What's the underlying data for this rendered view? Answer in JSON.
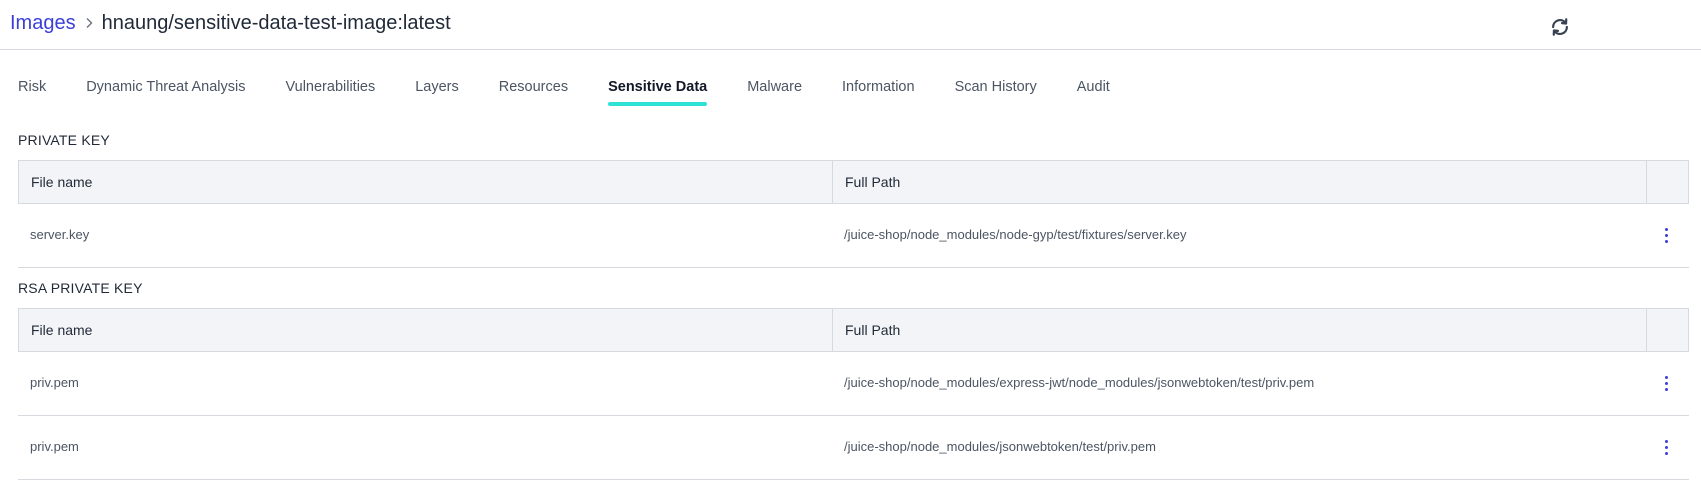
{
  "header": {
    "breadcrumb_link": "Images",
    "breadcrumb_current": "hnaung/sensitive-data-test-image:latest"
  },
  "tabs": [
    {
      "label": "Risk",
      "active": false
    },
    {
      "label": "Dynamic Threat Analysis",
      "active": false
    },
    {
      "label": "Vulnerabilities",
      "active": false
    },
    {
      "label": "Layers",
      "active": false
    },
    {
      "label": "Resources",
      "active": false
    },
    {
      "label": "Sensitive Data",
      "active": true
    },
    {
      "label": "Malware",
      "active": false
    },
    {
      "label": "Information",
      "active": false
    },
    {
      "label": "Scan History",
      "active": false
    },
    {
      "label": "Audit",
      "active": false
    }
  ],
  "sections": [
    {
      "title": "PRIVATE KEY",
      "columns": [
        "File name",
        "Full Path"
      ],
      "rows": [
        {
          "file_name": "server.key",
          "full_path": "/juice-shop/node_modules/node-gyp/test/fixtures/server.key"
        }
      ]
    },
    {
      "title": "RSA PRIVATE KEY",
      "columns": [
        "File name",
        "Full Path"
      ],
      "rows": [
        {
          "file_name": "priv.pem",
          "full_path": "/juice-shop/node_modules/express-jwt/node_modules/jsonwebtoken/test/priv.pem"
        },
        {
          "file_name": "priv.pem",
          "full_path": "/juice-shop/node_modules/jsonwebtoken/test/priv.pem"
        }
      ]
    }
  ],
  "colors": {
    "accent": "#2ee3d6",
    "link": "#3b3fd8",
    "header_bg": "#f3f4f7",
    "border": "#d6d9de"
  },
  "icons": {
    "breadcrumb_separator": "chevron-right-icon",
    "refresh": "refresh-icon",
    "row_menu": "more-vertical-icon"
  }
}
